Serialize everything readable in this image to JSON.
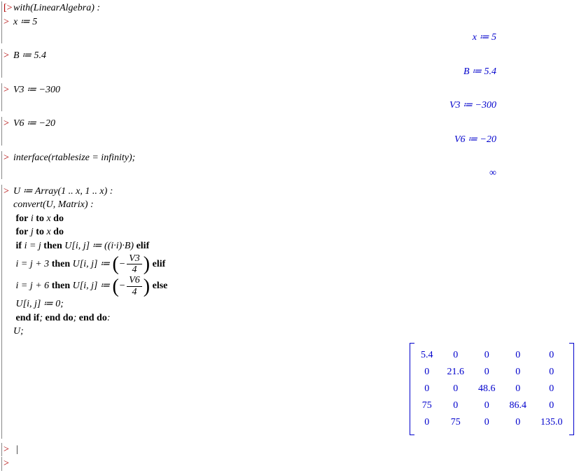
{
  "prompts": {
    "chev": ">"
  },
  "lines": {
    "withLA": "with(LinearAlgebra) :",
    "x_assign": "x ≔ 5",
    "B_assign": "B ≔  5.4",
    "V3_assign": "V3 ≔ −300",
    "V6_assign": "V6 ≔  −20",
    "interface": "interface(rtablesize = infinity);",
    "U_array": "U ≔  Array(1 ..  x, 1 ..  x) :",
    "convert": "convert(U, Matrix) :",
    "for_i": "for i  to x do",
    "for_j": "for j to x do",
    "if_start_a": "if i = j then U[i, j] ≔  ((i·i)·B) elif",
    "row_ij3_a": " i = j + 3 then U[i, j] ≔  ",
    "row_ij3_b": " elif",
    "row_ij6_a": " i = j + 6 then U[i, j] ≔  ",
    "row_ij6_b": " else",
    "U_zero": "U[i, j] ≔  0;",
    "endifs": " end if; end do; end do:",
    "U_semi": "U;",
    "frac_V3_num": "V3",
    "frac_V3_den": "4",
    "frac_V6_num": "V6",
    "frac_V6_den": "4"
  },
  "outputs": {
    "x": "x ≔  5",
    "B": "B ≔  5.4",
    "V3": "V3 ≔  −300",
    "V6": "V6 ≔  −20",
    "inf": "∞"
  },
  "chart_data": {
    "type": "table",
    "title": "U matrix output",
    "rows": [
      [
        "5.4",
        "0",
        "0",
        "0",
        "0"
      ],
      [
        "0",
        "21.6",
        "0",
        "0",
        "0"
      ],
      [
        "0",
        "0",
        "48.6",
        "0",
        "0"
      ],
      [
        "75",
        "0",
        "0",
        "86.4",
        "0"
      ],
      [
        "0",
        "75",
        "0",
        "0",
        "135.0"
      ]
    ]
  }
}
